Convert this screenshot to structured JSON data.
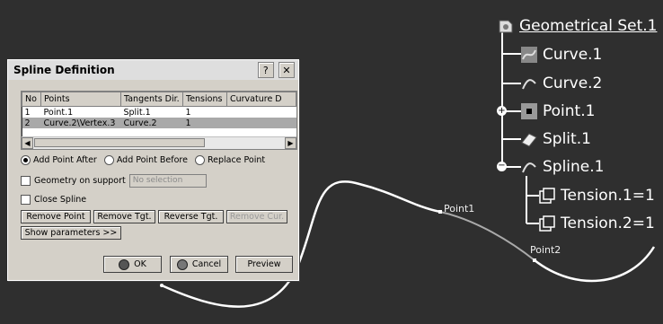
{
  "tree": {
    "root": {
      "label": "Geometrical Set.1",
      "icon": "geometrical-set-icon"
    },
    "items": [
      {
        "label": "Curve.1",
        "icon": "curve-icon"
      },
      {
        "label": "Curve.2",
        "icon": "curve-icon"
      },
      {
        "label": "Point.1",
        "icon": "point-icon"
      },
      {
        "label": "Split.1",
        "icon": "split-icon"
      },
      {
        "label": "Spline.1",
        "icon": "spline-icon"
      },
      {
        "label": "Tension.1=1",
        "icon": "tension-icon"
      },
      {
        "label": "Tension.2=1",
        "icon": "tension-icon"
      }
    ]
  },
  "viewport": {
    "point1_label": "Point1",
    "point2_label": "Point2"
  },
  "dialog": {
    "title": "Spline Definition",
    "help_label": "?",
    "close_label": "✕",
    "columns": [
      "No",
      "Points",
      "Tangents Dir.",
      "Tensions",
      "Curvature D"
    ],
    "rows": [
      [
        "1",
        "Point.1",
        "Split.1",
        "1",
        ""
      ],
      [
        "2",
        "Curve.2\\Vertex.3",
        "Curve.2",
        "1",
        ""
      ]
    ],
    "radios": {
      "add_after": "Add Point After",
      "add_before": "Add Point Before",
      "replace": "Replace Point"
    },
    "geometry_on_support": "Geometry on support",
    "support_placeholder": "No selection",
    "close_spline": "Close Spline",
    "buttons": {
      "remove_point": "Remove Point",
      "remove_tgt": "Remove Tgt.",
      "reverse_tgt": "Reverse Tgt.",
      "remove_cur": "Remove Cur.",
      "show_params": "Show parameters >>",
      "ok": "OK",
      "cancel": "Cancel",
      "preview": "Preview"
    }
  }
}
